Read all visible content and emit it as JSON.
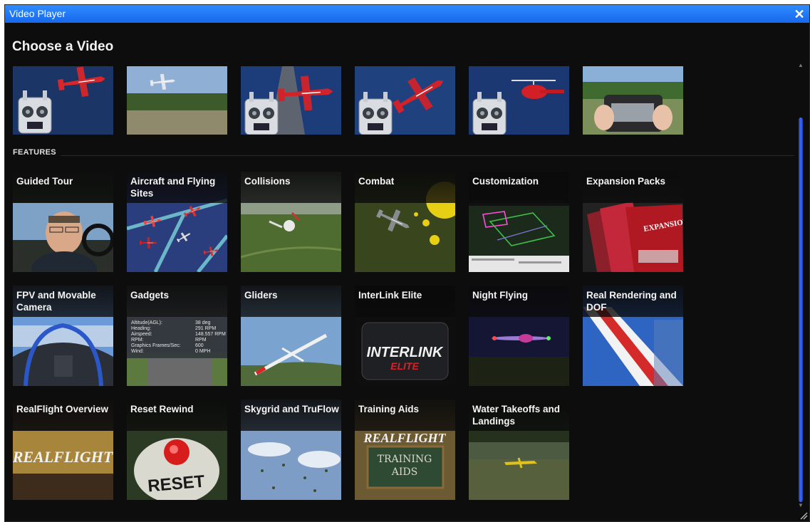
{
  "window": {
    "title": "Video Player",
    "close_glyph": "✕",
    "close_icon": "close-icon",
    "accent": "#1f78f5"
  },
  "heading": "Choose a Video",
  "top_videos": [
    {
      "scene": "transmitter-plane-flying"
    },
    {
      "scene": "plane-taking-off-field"
    },
    {
      "scene": "transmitter-plane-runway"
    },
    {
      "scene": "transmitter-plane-banking"
    },
    {
      "scene": "transmitter-helicopter"
    },
    {
      "scene": "hands-on-transmitter"
    }
  ],
  "features_label": "FEATURES",
  "features": [
    {
      "label": "Guided Tour"
    },
    {
      "label": "Aircraft and Flying Sites"
    },
    {
      "label": "Collisions"
    },
    {
      "label": "Combat"
    },
    {
      "label": "Customization"
    },
    {
      "label": "Expansion Packs"
    },
    {
      "label": "FPV and Movable Camera"
    },
    {
      "label": "Gadgets"
    },
    {
      "label": "Gliders"
    },
    {
      "label": "InterLink Elite"
    },
    {
      "label": "Night Flying"
    },
    {
      "label": "Real Rendering and DOF"
    },
    {
      "label": "RealFlight Overview"
    },
    {
      "label": "Reset Rewind"
    },
    {
      "label": "Skygrid and TruFlow"
    },
    {
      "label": "Training Aids"
    },
    {
      "label": "Water Takeoffs and Landings"
    }
  ],
  "tile_text": {
    "gadgets_lines": [
      "Altitude(AGL):",
      "Heading:",
      "Airspeed:",
      "RPM:",
      "Graphics Frames/Sec:",
      "Wind:"
    ],
    "gadgets_values": [
      "38 deg",
      "291 RPM",
      "148.557 RPM",
      "RPM",
      "600",
      "0 MPH"
    ],
    "interlink_logo": "INTERLINK",
    "interlink_sub": "ELITE",
    "realflight_logo": "REALFLIGHT",
    "reset_text": "RESET",
    "training_logo": "REALFLIGHT",
    "training_line1": "TRAINING",
    "training_line2": "AIDS",
    "expansion_logo": "EXPANSION PACK"
  },
  "scrollbar": {
    "up_glyph": "▲",
    "down_glyph": "▼"
  }
}
